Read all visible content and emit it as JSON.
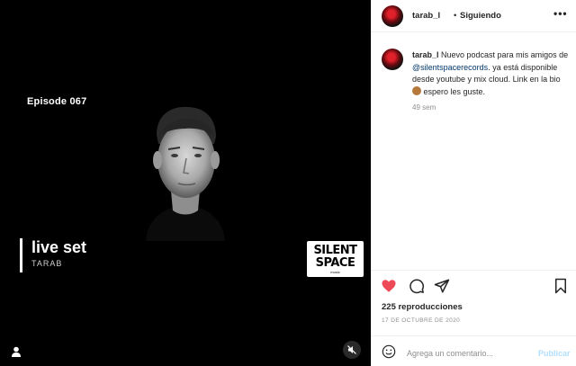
{
  "media": {
    "episode": "Episode 067",
    "title": "live set",
    "artist": "TARAB",
    "logo_line1": "SILENT",
    "logo_line2": "SPACE",
    "logo_line3": "music"
  },
  "header": {
    "username": "tarab_l",
    "separator": "•",
    "follow_status": "Siguiendo",
    "more": "•••"
  },
  "caption": {
    "username": "tarab_l",
    "text_before": " Nuevo podcast para mis amigos de ",
    "mention": "@silentspacerecords",
    "text_after": ". ya está disponible desde youtube y mix cloud. Link en la bio ",
    "text_end": " espero les guste.",
    "time": "49 sem"
  },
  "stats": {
    "views": "225 reproducciones",
    "date": "17 DE OCTUBRE DE 2020"
  },
  "comment": {
    "placeholder": "Agrega un comentario...",
    "publish": "Publicar"
  },
  "colors": {
    "heart": "#ed4956",
    "link": "#00376b",
    "publish_disabled": "#b2dffc"
  },
  "icons": [
    "user-icon",
    "mute-icon",
    "heart-icon",
    "comment-icon",
    "share-icon",
    "bookmark-icon",
    "smile-icon"
  ]
}
